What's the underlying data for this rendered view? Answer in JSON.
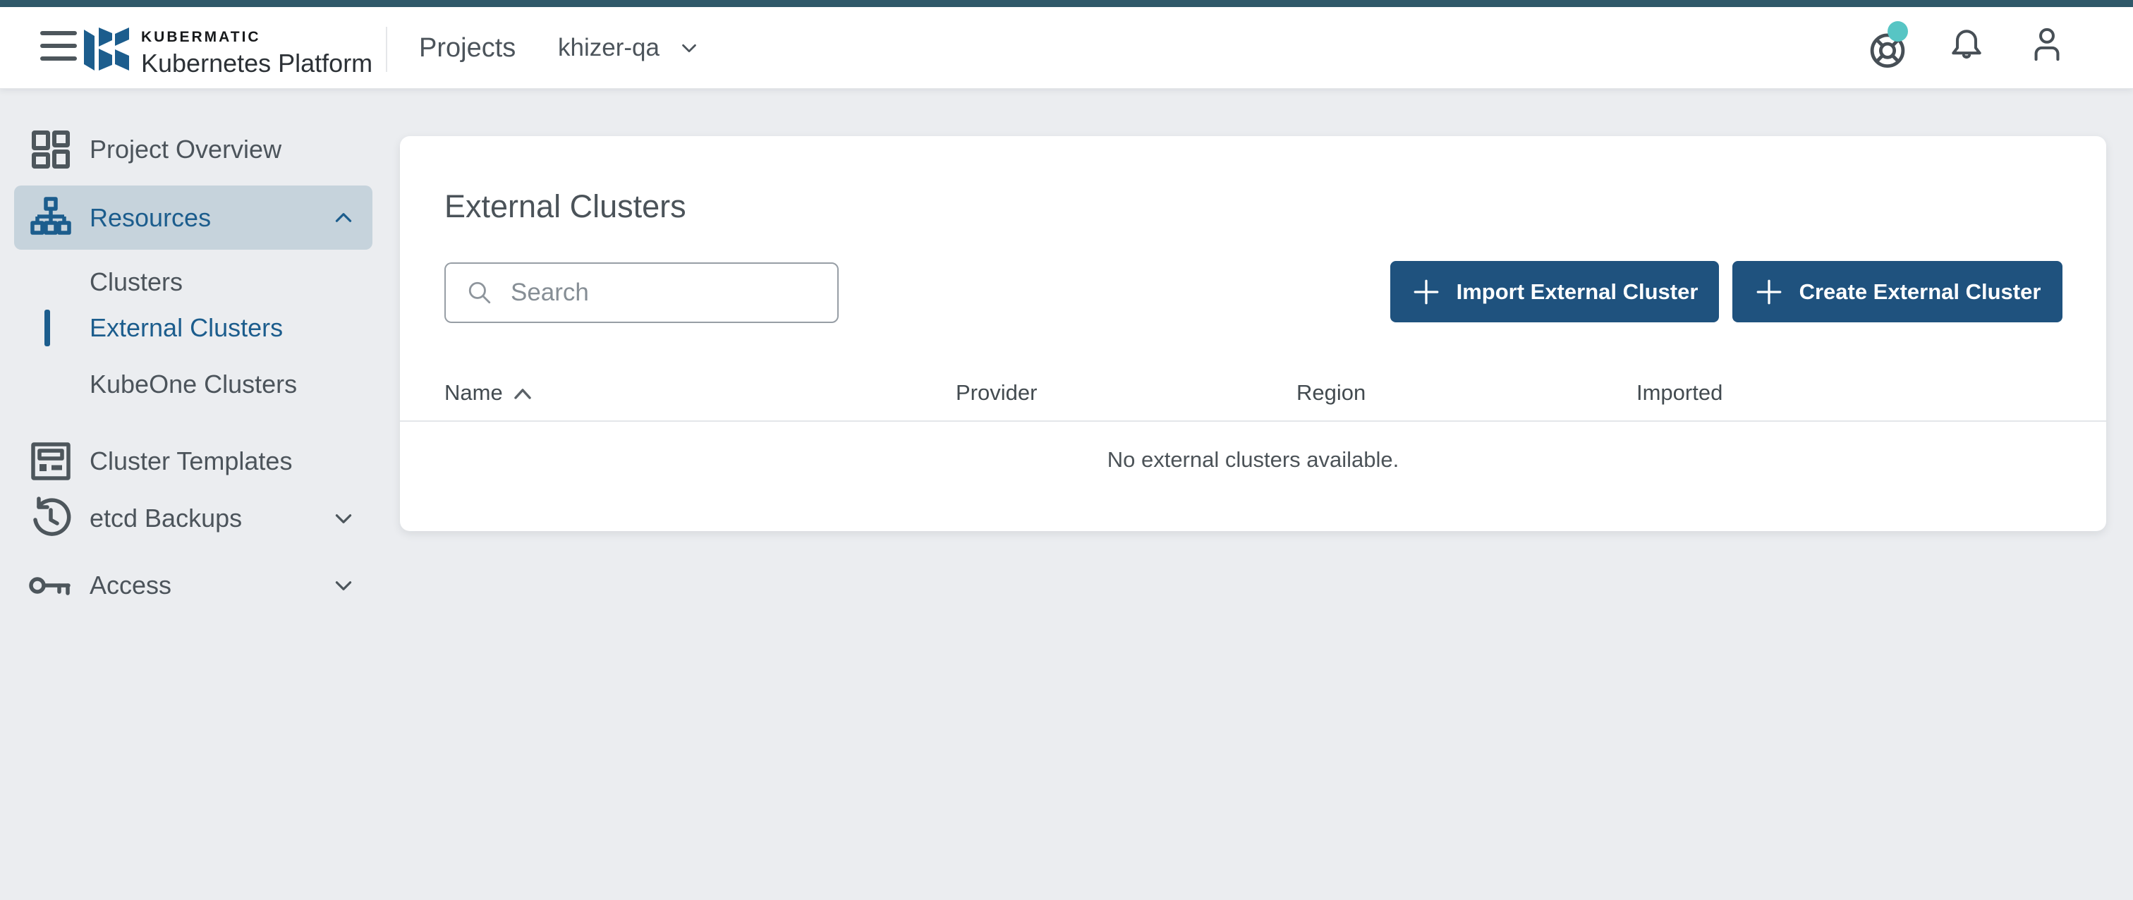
{
  "colors": {
    "top_strip": "#30596a",
    "accent_blue": "#1c5d8d",
    "button_blue": "#1f527e",
    "badge_teal": "#57c5c4",
    "active_row_bg": "#c6d3dc",
    "page_bg": "#ebedf0"
  },
  "header": {
    "brand_name": "KUBERMATIC",
    "brand_subtitle": "Kubernetes Platform",
    "nav_title": "Projects",
    "project_name": "khizer-qa",
    "icons": [
      "hamburger-icon",
      "help-buoy-icon",
      "bell-icon",
      "user-icon"
    ],
    "help_badge": true
  },
  "sidebar": {
    "items": [
      {
        "label": "Project Overview",
        "icon": "dashboard-icon"
      },
      {
        "label": "Resources",
        "icon": "sitemap-icon",
        "expanded": true,
        "active": true
      },
      {
        "label": "Clusters",
        "child": true
      },
      {
        "label": "External Clusters",
        "child": true,
        "selected": true
      },
      {
        "label": "KubeOne Clusters",
        "child": true
      },
      {
        "label": "Cluster Templates",
        "icon": "template-icon"
      },
      {
        "label": "etcd Backups",
        "icon": "history-icon",
        "expanded": false
      },
      {
        "label": "Access",
        "icon": "key-icon",
        "expanded": false
      }
    ]
  },
  "main": {
    "title": "External Clusters",
    "search_placeholder": "Search",
    "import_button": "Import External Cluster",
    "create_button": "Create External Cluster",
    "table": {
      "columns": [
        "Name",
        "Provider",
        "Region",
        "Imported"
      ],
      "sort_column": "Name",
      "sort_direction": "asc",
      "empty_message": "No external clusters available."
    }
  }
}
